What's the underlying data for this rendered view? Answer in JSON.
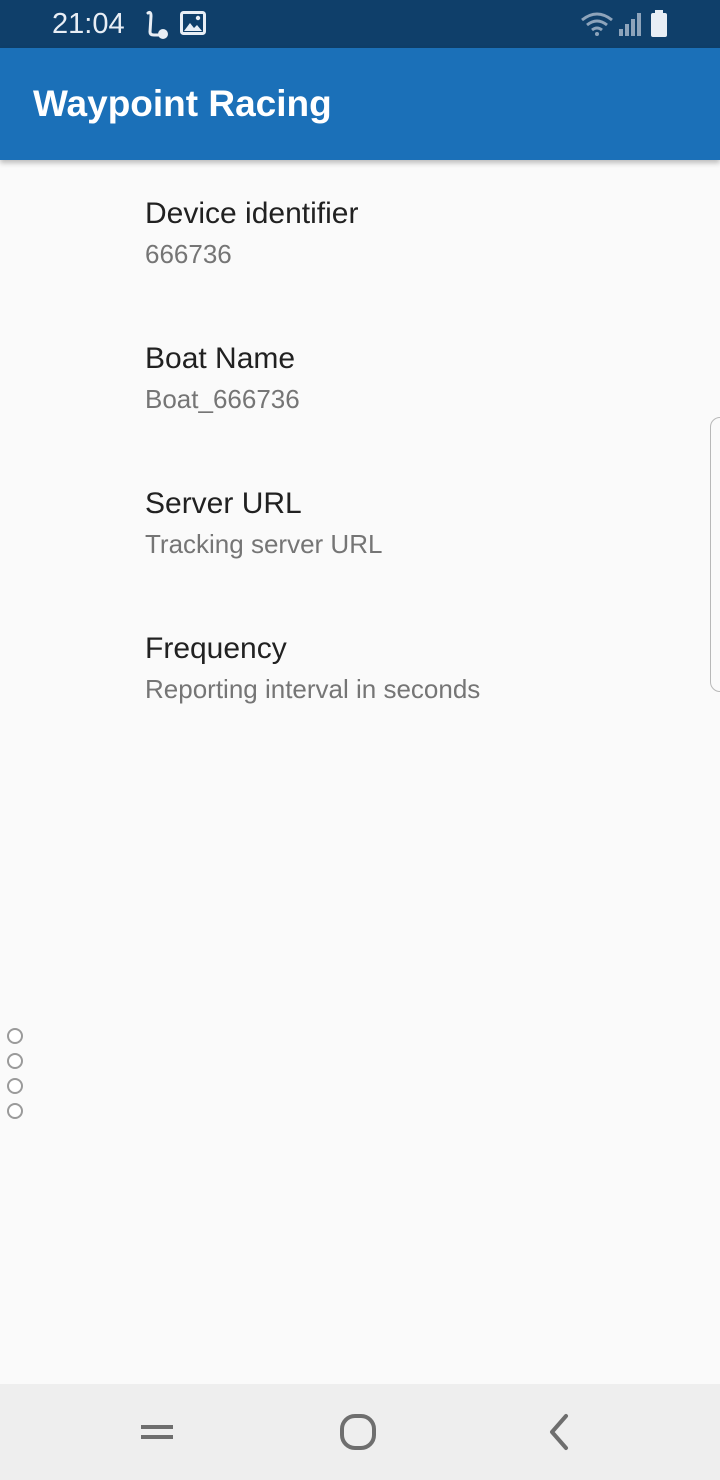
{
  "status_bar": {
    "time": "21:04",
    "icons": [
      "notification-l-icon",
      "image-icon",
      "wifi-icon",
      "signal-icon",
      "battery-icon"
    ]
  },
  "app_bar": {
    "title": "Waypoint Racing"
  },
  "preferences": [
    {
      "title": "Device identifier",
      "summary": "666736"
    },
    {
      "title": "Boat Name",
      "summary": "Boat_666736"
    },
    {
      "title": "Server URL",
      "summary": "Tracking server URL"
    },
    {
      "title": "Frequency",
      "summary": "Reporting interval in seconds"
    }
  ],
  "nav_bar": {
    "icons": [
      "recent-apps-icon",
      "home-icon",
      "back-icon"
    ]
  },
  "colors": {
    "status_bar": "#0f3f6a",
    "app_bar": "#1b70b8",
    "background": "#fafafa",
    "title_text": "#212121",
    "summary_text": "#757575"
  }
}
